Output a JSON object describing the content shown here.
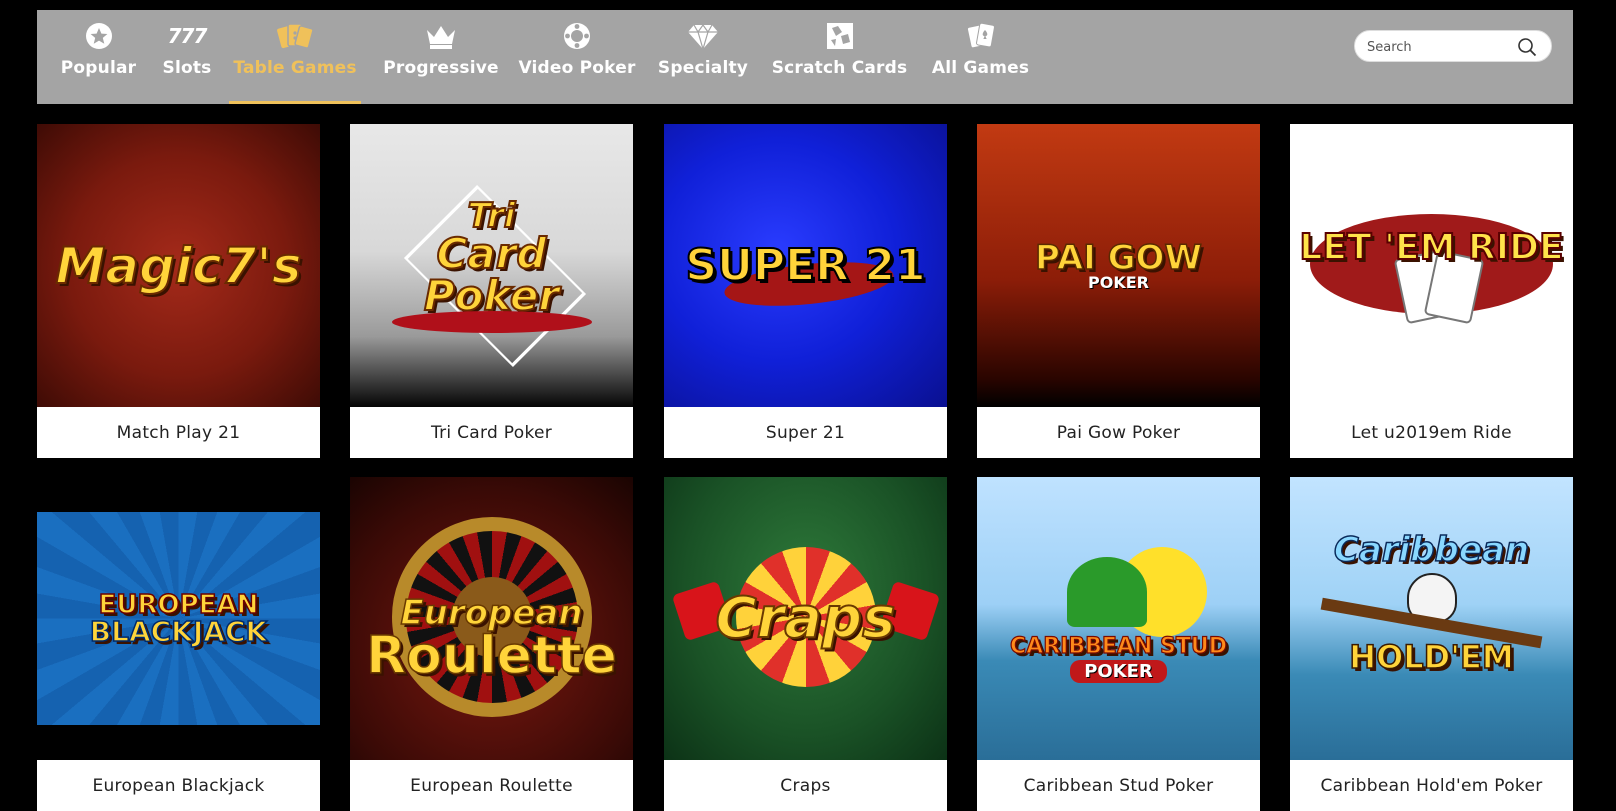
{
  "nav": {
    "items": [
      {
        "label": "Popular"
      },
      {
        "label": "Slots",
        "icon_text": "777"
      },
      {
        "label": "Table Games"
      },
      {
        "label": "Progressive"
      },
      {
        "label": "Video Poker"
      },
      {
        "label": "Specialty"
      },
      {
        "label": "Scratch Cards"
      },
      {
        "label": "All Games"
      }
    ],
    "active": "Table Games",
    "active_color": "#f0c15a"
  },
  "search": {
    "placeholder": "Search"
  },
  "games": [
    {
      "caption": "Match Play 21",
      "logo": [
        "Magic7's"
      ]
    },
    {
      "caption": "Tri Card Poker",
      "logo": [
        "Tri",
        "Card",
        "Poker"
      ]
    },
    {
      "caption": "Super 21",
      "logo": [
        "SUPER 21"
      ]
    },
    {
      "caption": "Pai Gow Poker",
      "logo": [
        "PAI GOW",
        "POKER"
      ]
    },
    {
      "caption": "Let u2019em Ride",
      "logo": [
        "LET 'EM RIDE"
      ]
    },
    {
      "caption": "European Blackjack",
      "logo": [
        "EUROPEAN",
        "BLACKJACK"
      ]
    },
    {
      "caption": "European Roulette",
      "logo": [
        "European",
        "Roulette"
      ]
    },
    {
      "caption": "Craps",
      "logo": [
        "Craps"
      ]
    },
    {
      "caption": "Caribbean Stud Poker",
      "logo": [
        "CARIBBEAN STUD",
        "POKER"
      ]
    },
    {
      "caption": "Caribbean Hold'em Poker",
      "logo": [
        "Caribbean",
        "HOLD'EM"
      ]
    }
  ]
}
